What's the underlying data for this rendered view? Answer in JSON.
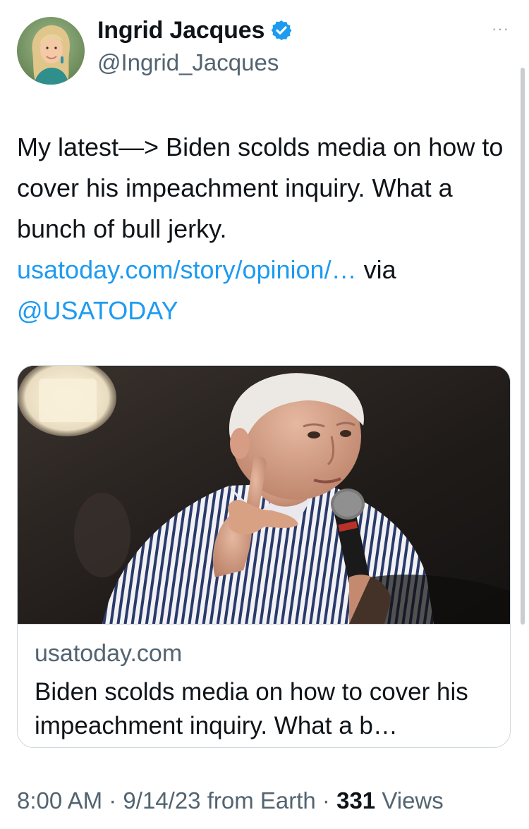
{
  "author": {
    "display_name": "Ingrid Jacques",
    "handle": "@Ingrid_Jacques",
    "verified_icon": "verified-badge-icon",
    "verified_color": "#1d9bf0"
  },
  "menu": {
    "more_label": "···"
  },
  "tweet": {
    "text_part1": "My latest—> Biden scolds media on how to cover his impeachment inquiry. What a bunch of bull jerky.",
    "link_text": "usatoday.com/story/opinion/…",
    "via_text": "via",
    "mention": "@USATODAY"
  },
  "card": {
    "domain": "usatoday.com",
    "title": "Biden scolds media on how to cover his impeachment inquiry. What a b…"
  },
  "meta": {
    "time": "8:00 AM",
    "sep1": "·",
    "date": "9/14/23",
    "source": "from Earth",
    "sep2": "·",
    "views_count": "331",
    "views_label": "Views"
  },
  "colors": {
    "link": "#1d9bf0",
    "secondary_text": "#536471",
    "primary_text": "#0f1419",
    "border": "#cfd9de"
  }
}
